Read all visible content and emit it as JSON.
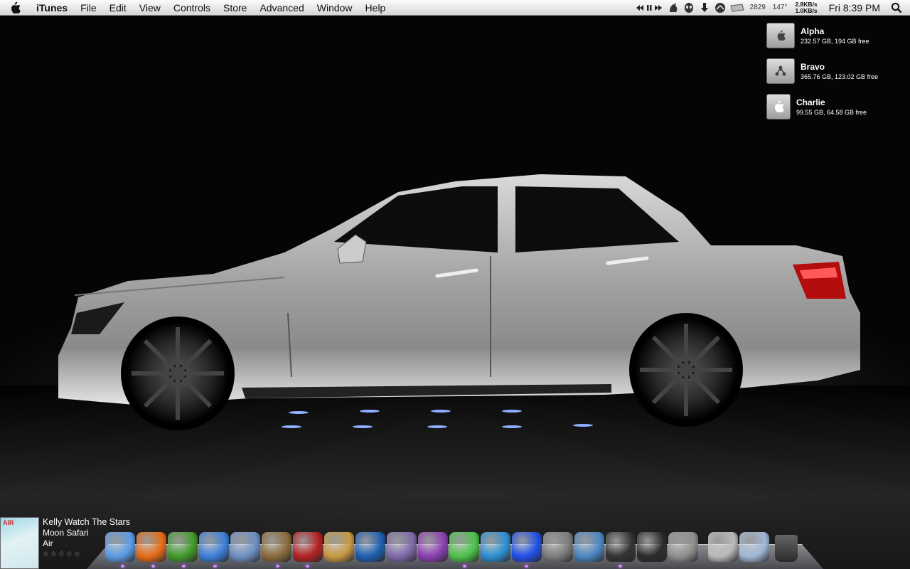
{
  "menubar": {
    "apple_icon": "apple-logo-icon",
    "app_name": "iTunes",
    "menus": [
      "File",
      "Edit",
      "View",
      "Controls",
      "Store",
      "Advanced",
      "Window",
      "Help"
    ],
    "status": {
      "itunes_controls_icon": "media-controls-icon",
      "growl_icon": "growl-icon",
      "alien_icon": "alien-icon",
      "download_icon": "download-arrow-icon",
      "sync_icon": "sync-icon",
      "mail_icon": "mail-icon",
      "counter": "2829",
      "temperature": "147°",
      "net_up": "2.8KB/s",
      "net_down": "1.0KB/s",
      "clock": "Fri 8:39 PM",
      "spotlight_icon": "spotlight-search-icon"
    }
  },
  "drives": [
    {
      "name": "Alpha",
      "info": "232.57 GB, 194 GB free",
      "icon": "hard-drive-icon"
    },
    {
      "name": "Bravo",
      "info": "365.76 GB, 123.02 GB free",
      "icon": "firewire-drive-icon"
    },
    {
      "name": "Charlie",
      "info": "99.55 GB, 64.58 GB free",
      "icon": "hard-drive-icon"
    }
  ],
  "now_playing": {
    "title": "Kelly Watch The Stars",
    "album": "Moon Safari",
    "artist": "Air",
    "rating": "☆☆☆☆☆",
    "album_art_label": "AIR"
  },
  "dock": {
    "apps": [
      {
        "name": "finder-icon",
        "color": "#5a9be6"
      },
      {
        "name": "firefox-icon",
        "color": "#e66b16"
      },
      {
        "name": "adium-duck-icon",
        "color": "#3f9b2a"
      },
      {
        "name": "itunes-icon",
        "color": "#3b7fd9"
      },
      {
        "name": "mail-stamp-icon",
        "color": "#6e8fc4"
      },
      {
        "name": "iphoto-icon",
        "color": "#8a6b3a"
      },
      {
        "name": "photo-booth-icon",
        "color": "#b32020"
      },
      {
        "name": "preview-icon",
        "color": "#c89a42"
      },
      {
        "name": "photoshop-icon",
        "color": "#1d5fb0"
      },
      {
        "name": "textmate-icon",
        "color": "#7d6aa8"
      },
      {
        "name": "illustrator-icon",
        "color": "#8a3fb2"
      },
      {
        "name": "messages-icon",
        "color": "#4cc34a"
      },
      {
        "name": "quicksilver-icon",
        "color": "#2b8fd3"
      },
      {
        "name": "dashboard-icon",
        "color": "#1f4fe8"
      },
      {
        "name": "transmit-truck-icon",
        "color": "#7c7c7c"
      },
      {
        "name": "network-utility-icon",
        "color": "#4a86c2"
      },
      {
        "name": "camino-icon",
        "color": "#333333"
      },
      {
        "name": "activity-monitor-icon",
        "color": "#2b2b2b"
      },
      {
        "name": "system-preferences-icon",
        "color": "#8f8f8f"
      }
    ],
    "stacks": [
      {
        "name": "downloads-stack-icon",
        "color": "#b9b9b9"
      },
      {
        "name": "applications-stack-icon",
        "color": "#9fb8d6"
      }
    ],
    "trash": {
      "name": "trash-icon",
      "color": "#4a4a4a"
    }
  },
  "colors": {
    "menubar": "#e7e7e7",
    "desktop": "#000000",
    "car_body": "#b9b9b9",
    "dock_indicator": "#d38cff"
  }
}
